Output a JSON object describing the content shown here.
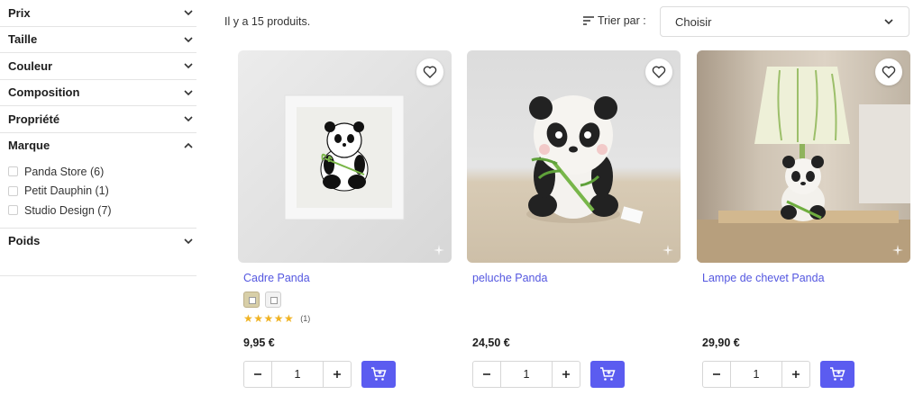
{
  "filters": [
    {
      "title": "Prix",
      "expanded": false
    },
    {
      "title": "Taille",
      "expanded": false
    },
    {
      "title": "Couleur",
      "expanded": false
    },
    {
      "title": "Composition",
      "expanded": false
    },
    {
      "title": "Propriété",
      "expanded": false
    },
    {
      "title": "Marque",
      "expanded": true,
      "options": [
        "Panda Store (6)",
        "Petit Dauphin (1)",
        "Studio Design (7)"
      ]
    },
    {
      "title": "Poids",
      "expanded": false
    }
  ],
  "results": {
    "count_text": "Il y a 15 produits."
  },
  "sort": {
    "label": "Trier par :",
    "value": "Choisir"
  },
  "products": [
    {
      "name": "Cadre Panda",
      "price": "9,95 €",
      "quantity": "1",
      "rating": 5,
      "rating_max": 5,
      "stars": "★★★★★",
      "reviews": "(1)"
    },
    {
      "name": "peluche Panda",
      "price": "24,50 €",
      "quantity": "1"
    },
    {
      "name": "Lampe de chevet Panda",
      "price": "29,90 €",
      "quantity": "1"
    }
  ],
  "colors": {
    "accent": "#5b5cf0",
    "link": "#5457e0",
    "star": "#f0b323"
  },
  "icons": [
    "chevron-down-icon",
    "chevron-up-icon",
    "sort-icon",
    "heart-icon",
    "sparkle-icon",
    "minus-icon",
    "plus-icon",
    "cart-add-icon"
  ]
}
